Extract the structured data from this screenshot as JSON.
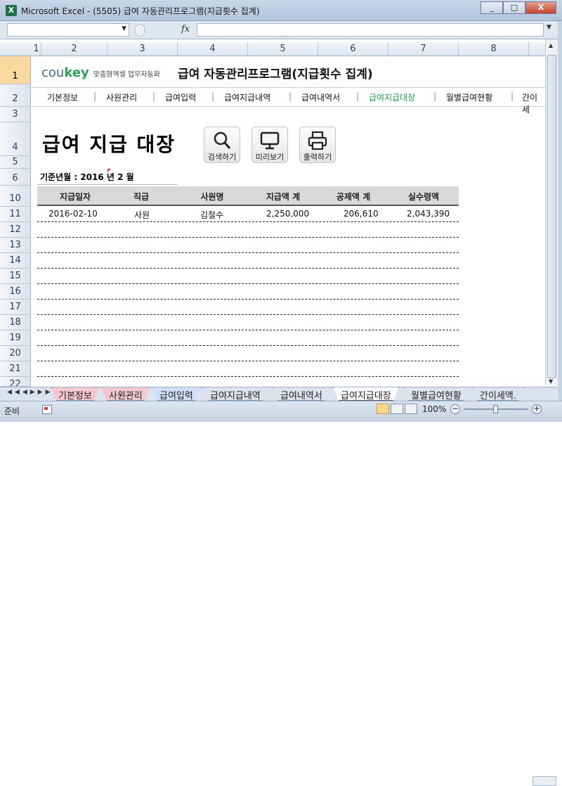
{
  "window": {
    "title": "Microsoft Excel - (5505) 급여 자동관리프로그램(지급횟수 집계)",
    "app_icon": "X",
    "min": "_",
    "restore": "□",
    "close": "X"
  },
  "formula_bar": {
    "name_box": "",
    "fx": "fx",
    "value": ""
  },
  "columns": [
    "1",
    "2",
    "3",
    "4",
    "5",
    "6",
    "7",
    "8"
  ],
  "rows": [
    "1",
    "2",
    "3",
    "4",
    "5",
    "6",
    "10",
    "11",
    "12",
    "13",
    "14",
    "15",
    "16",
    "17",
    "18",
    "19",
    "20",
    "21",
    "22"
  ],
  "brand": {
    "name_a": "cou",
    "name_b": "key",
    "tagline": "맞춤형엑셀 업무자동화"
  },
  "app_title": "급여 자동관리프로그램(지급횟수 집계)",
  "menu": {
    "items": [
      "기본정보",
      "사원관리",
      "급여입력",
      "급여지급내역",
      "급여내역서",
      "급여지급대장",
      "월별급여현황",
      "간이세"
    ],
    "separator": "|",
    "active_color": "#1f9a4c"
  },
  "page_heading": "급여 지급 대장",
  "toolbar": {
    "search": "검색하기",
    "preview": "미리보기",
    "print": "출력하기"
  },
  "period": {
    "label": "기준년월 : 2016 년  2 월"
  },
  "table": {
    "headers": [
      "지급일자",
      "직급",
      "사원명",
      "지급액 계",
      "공제액 계",
      "실수령액"
    ],
    "rows": [
      [
        "2016-02-10",
        "사원",
        "김철수",
        "2,250,000",
        "206,610",
        "2,043,390"
      ]
    ]
  },
  "sheet_tabs": [
    "기본정보",
    "사원관리",
    "급여입력",
    "급여지급내역",
    "급여내역서",
    "급여지급대장",
    "월별급여현황",
    "간이세액."
  ],
  "active_tab": "급여지급대장",
  "status": {
    "ready": "준비",
    "zoom": "100%"
  }
}
